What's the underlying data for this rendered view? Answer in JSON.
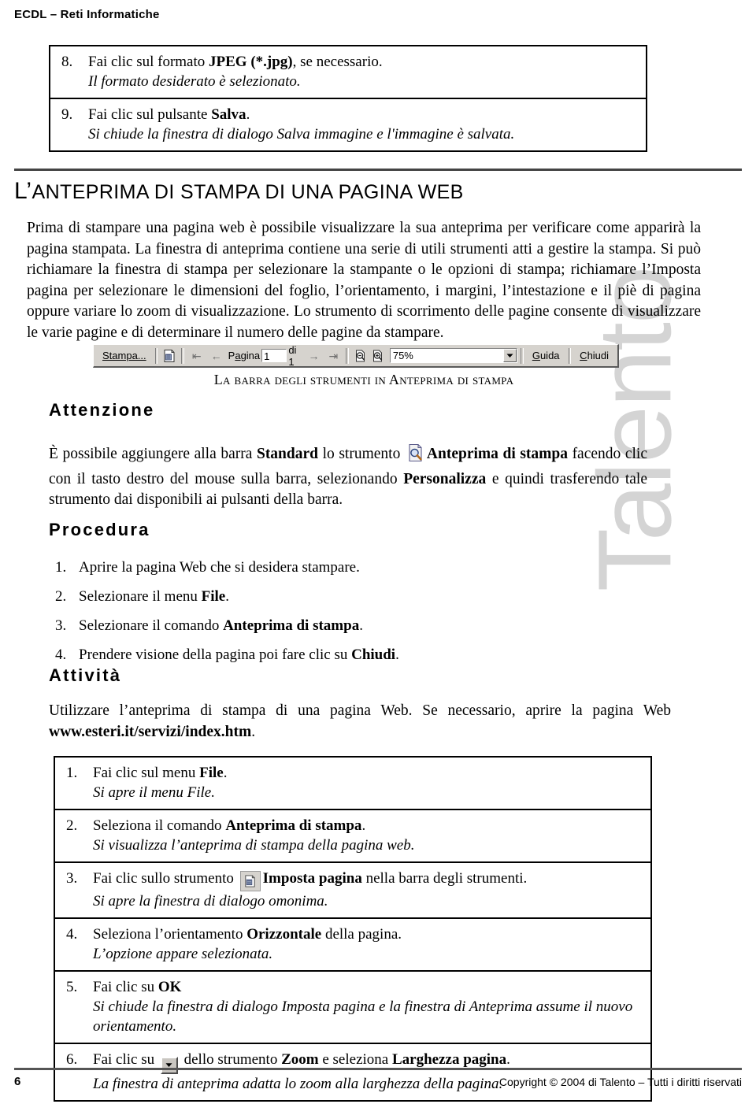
{
  "header": {
    "title": "ECDL – Reti Informatiche"
  },
  "watermark": {
    "text": "Talento"
  },
  "top_steps": [
    {
      "num": "8.",
      "action_prefix": "Fai clic sul formato ",
      "action_bold": "JPEG (*.jpg)",
      "action_suffix": ", se necessario.",
      "result": "Il formato desiderato è selezionato."
    },
    {
      "num": "9.",
      "action_prefix": "Fai clic sul pulsante ",
      "action_bold": "Salva",
      "action_suffix": ".",
      "result": "Si chiude la finestra di dialogo Salva immagine e l'immagine è salvata."
    }
  ],
  "section": {
    "title_cap": "L’",
    "title_rest": "ANTEPRIMA DI STAMPA DI UNA PAGINA WEB",
    "intro": "Prima di stampare una pagina web è possibile visualizzare la sua anteprima per verificare come apparirà la pagina stampata. La finestra di anteprima contiene una serie di utili strumenti atti a gestire la stampa. Si può richiamare la finestra di stampa per selezionare la stampante o le opzioni di stampa; richiamare l’Imposta pagina per selezionare le dimensioni del foglio, l’orientamento, i margini, l’intestazione e il piè di pagina oppure variare lo zoom di visualizzazione. Lo strumento di scorrimento delle pagine consente di visualizzare le varie pagine e di determinare il numero delle pagine da stampare."
  },
  "toolbar": {
    "print_label": "Stampa...",
    "page_setup_icon": "page-setup-icon",
    "first_page_icon": "first-page-icon",
    "prev_page_icon": "previous-page-icon",
    "page_label": "Pagina",
    "page_value": "1",
    "of_label": "di 1",
    "next_page_icon": "next-page-icon",
    "last_page_icon": "last-page-icon",
    "zoom_out_icon": "zoom-out-icon",
    "zoom_in_icon": "zoom-in-icon",
    "zoom_value": "75%",
    "zoom_dropdown_icon": "chevron-down-icon",
    "help_label": "Guida",
    "close_label": "Chiudi",
    "caption": "La barra degli strumenti in Anteprima di stampa"
  },
  "attenzione": {
    "heading": "Attenzione",
    "text_a": "È possibile aggiungere alla barra ",
    "bold_a": "Standard",
    "text_b": " lo strumento ",
    "icon": "print-preview-icon",
    "bold_b": "Anteprima di stampa",
    "text_c": " facendo clic con il tasto destro del mouse sulla barra, selezionando ",
    "bold_c": "Personalizza",
    "text_d": " e quindi trasferendo tale strumento dai disponibili ai pulsanti della barra."
  },
  "procedura": {
    "heading": "Procedura",
    "items": [
      {
        "n": "1.",
        "prefix": "Aprire la pagina Web che si desidera stampare.",
        "bold": "",
        "suffix": ""
      },
      {
        "n": "2.",
        "prefix": "Selezionare il menu ",
        "bold": "File",
        "suffix": "."
      },
      {
        "n": "3.",
        "prefix": "Selezionare il comando ",
        "bold": "Anteprima di stampa",
        "suffix": "."
      },
      {
        "n": "4.",
        "prefix": "Prendere visione della pagina poi fare clic su ",
        "bold": "Chiudi",
        "suffix": "."
      }
    ]
  },
  "attivita": {
    "heading": "Attività",
    "text_a": "Utilizzare l’anteprima di stampa di una pagina Web. Se necessario, aprire la pagina Web ",
    "bold_url": "www.esteri.it/servizi/index.htm",
    "text_b": "."
  },
  "bottom_steps": [
    {
      "num": "1.",
      "prefix": "Fai clic sul menu ",
      "bold": "File",
      "suffix": ".",
      "icon": "",
      "result": "Si apre il menu File."
    },
    {
      "num": "2.",
      "prefix": "Seleziona il comando ",
      "bold": "Anteprima di stampa",
      "suffix": ".",
      "icon": "",
      "result": "Si visualizza l’anteprima di stampa della pagina web."
    },
    {
      "num": "3.",
      "prefix": "Fai clic sullo strumento ",
      "bold": "Imposta pagina",
      "suffix": " nella barra degli strumenti.",
      "icon": "page-setup-icon",
      "result": "Si apre la finestra di dialogo omonima."
    },
    {
      "num": "4.",
      "prefix": "Seleziona l’orientamento ",
      "bold": "Orizzontale",
      "suffix": " della pagina.",
      "icon": "",
      "result": "L’opzione appare selezionata."
    },
    {
      "num": "5.",
      "prefix": "Fai clic su ",
      "bold": "OK",
      "suffix": "",
      "icon": "",
      "result": "Si chiude la finestra di dialogo Imposta pagina e la finestra di Anteprima assume il nuovo orientamento."
    },
    {
      "num": "6.",
      "prefix": "Fai clic su ",
      "bold": "Zoom",
      "suffix": " e seleziona ",
      "bold2": "Larghezza pagina",
      "suffix2": ".",
      "mid": " dello strumento ",
      "icon": "dropdown-arrow-icon",
      "result": "La finestra di anteprima adatta lo zoom alla larghezza della pagina."
    }
  ],
  "footer": {
    "page_number": "6",
    "copyright": "Copyright © 2004 di Talento – Tutti i diritti riservati"
  },
  "colors": {
    "toolbar_face": "#d6d3ce",
    "watermark": "#d4d4d4",
    "rule": "#444444"
  }
}
